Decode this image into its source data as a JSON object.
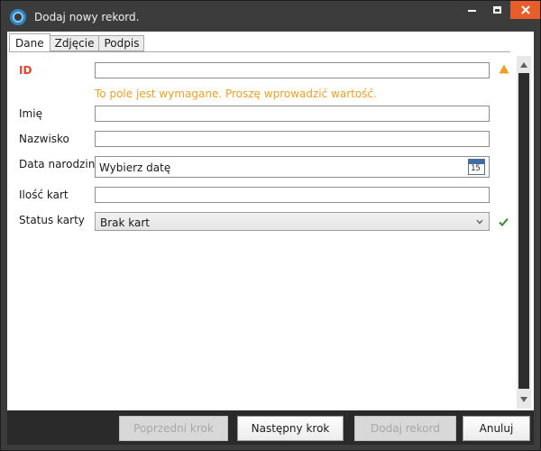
{
  "window": {
    "title": "Dodaj nowy rekord.",
    "colors": {
      "close_button": "#e85d2a",
      "chrome": "#3c3c3c",
      "error": "#e0452b",
      "warning": "#f0a020",
      "valid": "#2f8f2f"
    }
  },
  "tabs": [
    {
      "label": "Dane",
      "active": true
    },
    {
      "label": "Zdjęcie",
      "active": false
    },
    {
      "label": "Podpis",
      "active": false
    }
  ],
  "form": {
    "id": {
      "label": "ID",
      "value": "",
      "required": true,
      "error": "To pole jest wymagane. Proszę wprowadzić wartość.",
      "status_icon": "warning-triangle-icon"
    },
    "first_name": {
      "label": "Imię",
      "value": ""
    },
    "last_name": {
      "label": "Nazwisko",
      "value": ""
    },
    "birth_date": {
      "label": "Data narodzin",
      "value": "Wybierz datę",
      "icon": "calendar-icon",
      "icon_text": "15"
    },
    "card_count": {
      "label": "Ilość kart",
      "value": ""
    },
    "card_status": {
      "label": "Status karty",
      "value": "Brak kart",
      "status_icon": "checkmark-icon"
    }
  },
  "footer": {
    "prev_label": "Poprzedni krok",
    "next_label": "Następny krok",
    "add_label": "Dodaj rekord",
    "cancel_label": "Anuluj"
  }
}
